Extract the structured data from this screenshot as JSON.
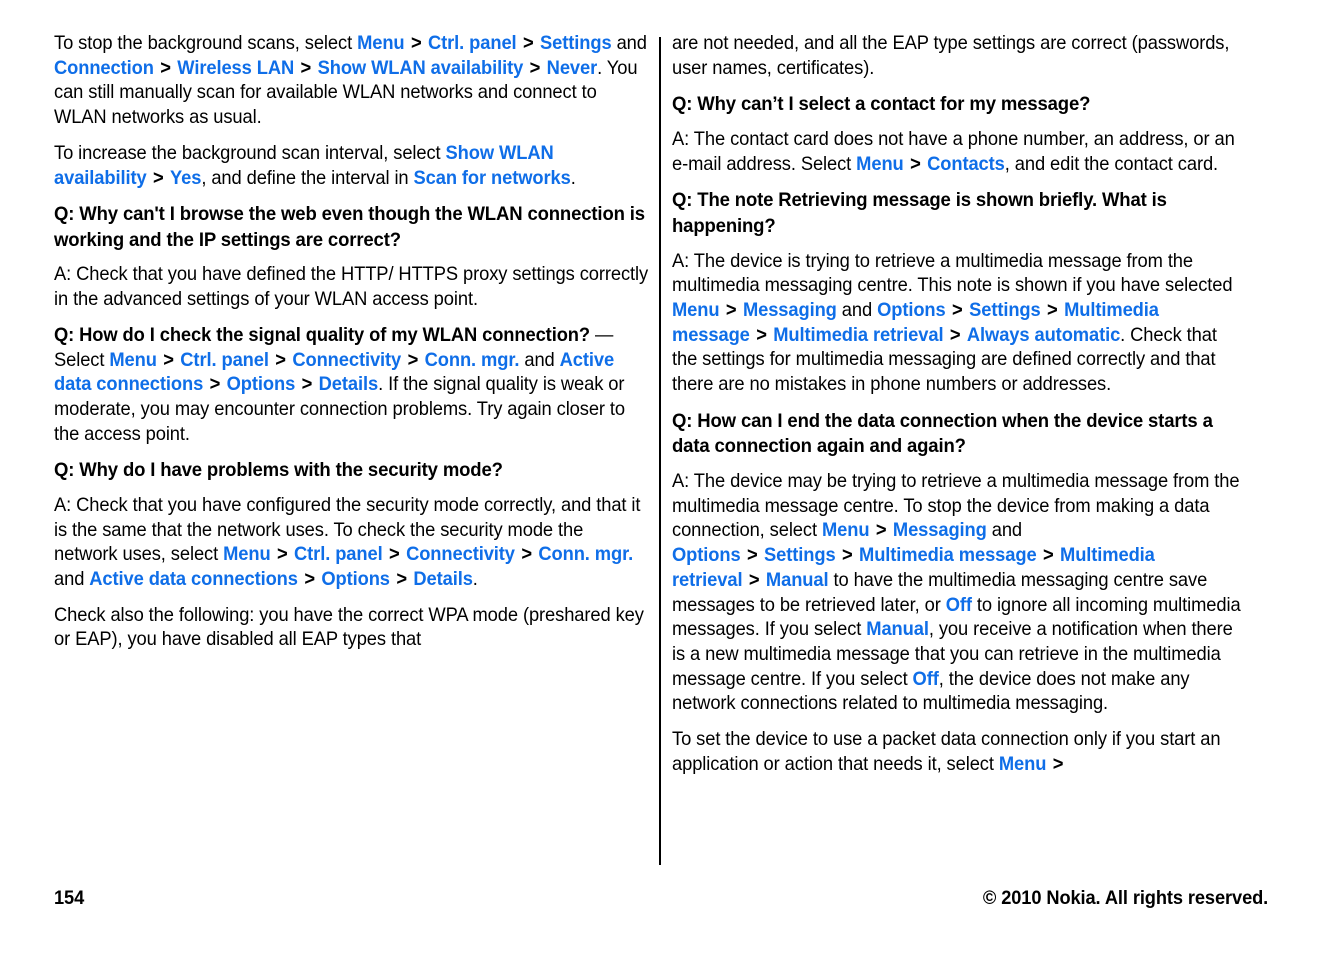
{
  "document": {
    "page_number": "154",
    "copyright": "© 2010 Nokia. All rights reserved.",
    "link_color": "#0f6ee8",
    "text_color": "#000000",
    "background_color": "#ffffff"
  },
  "left_column": {
    "blocks": [
      {
        "type": "paragraph",
        "id": "stop-background-scans",
        "runs": [
          {
            "t": "plain",
            "v": "To stop the background scans, select "
          },
          {
            "t": "link",
            "v": "Menu"
          },
          {
            "t": "sep",
            "v": ">"
          },
          {
            "t": "link",
            "v": "Ctrl. panel"
          },
          {
            "t": "sep",
            "v": ">"
          },
          {
            "t": "link",
            "v": "Settings"
          },
          {
            "t": "plain",
            "v": " and "
          },
          {
            "t": "link",
            "v": "Connection"
          },
          {
            "t": "sep",
            "v": ">"
          },
          {
            "t": "link",
            "v": "Wireless LAN"
          },
          {
            "t": "sep",
            "v": ">"
          },
          {
            "t": "link",
            "v": "Show WLAN availability"
          },
          {
            "t": "sep",
            "v": ">"
          },
          {
            "t": "link",
            "v": "Never"
          },
          {
            "t": "plain",
            "v": ". You can still manually scan for available WLAN networks and connect to WLAN networks as usual."
          }
        ]
      },
      {
        "type": "paragraph",
        "id": "increase-scan-interval",
        "runs": [
          {
            "t": "plain",
            "v": "To increase the background scan interval, select "
          },
          {
            "t": "link",
            "v": "Show WLAN availability"
          },
          {
            "t": "sep",
            "v": ">"
          },
          {
            "t": "link",
            "v": "Yes"
          },
          {
            "t": "plain",
            "v": ", and define the interval in "
          },
          {
            "t": "link",
            "v": "Scan for networks"
          },
          {
            "t": "plain",
            "v": "."
          }
        ]
      },
      {
        "type": "heading",
        "id": "q-browse-web",
        "runs": [
          {
            "t": "plain",
            "v": "Q: Why can't I browse the web even though the WLAN connection is working and the IP settings are correct?"
          }
        ]
      },
      {
        "type": "paragraph",
        "id": "a-browse-web",
        "runs": [
          {
            "t": "plain",
            "v": "A: Check that you have defined the HTTP/ HTTPS proxy settings correctly in the advanced settings of your WLAN access point."
          }
        ]
      },
      {
        "type": "paragraph",
        "id": "q-signal-quality",
        "runs": [
          {
            "t": "bold",
            "v": "Q: How do I check the signal quality of my WLAN connection?"
          },
          {
            "t": "plain",
            "v": " —  Select "
          },
          {
            "t": "link",
            "v": "Menu"
          },
          {
            "t": "sep",
            "v": ">"
          },
          {
            "t": "link",
            "v": "Ctrl. panel"
          },
          {
            "t": "sep",
            "v": ">"
          },
          {
            "t": "link",
            "v": "Connectivity"
          },
          {
            "t": "sep",
            "v": ">"
          },
          {
            "t": "link",
            "v": "Conn. mgr."
          },
          {
            "t": "plain",
            "v": " and "
          },
          {
            "t": "link",
            "v": "Active data connections"
          },
          {
            "t": "sep",
            "v": ">"
          },
          {
            "t": "link",
            "v": "Options"
          },
          {
            "t": "sep",
            "v": ">"
          },
          {
            "t": "link",
            "v": "Details"
          },
          {
            "t": "plain",
            "v": ". If the signal quality is weak or moderate, you may encounter connection problems. Try again closer to the access point."
          }
        ]
      },
      {
        "type": "heading",
        "id": "q-security-mode",
        "runs": [
          {
            "t": "plain",
            "v": "Q: Why do I have problems with the security mode?"
          }
        ]
      },
      {
        "type": "paragraph",
        "id": "a-security-mode",
        "runs": [
          {
            "t": "plain",
            "v": "A: Check that you have configured the security mode correctly, and that it is the same that the network uses. To check the security mode the network uses, select "
          },
          {
            "t": "link",
            "v": "Menu"
          },
          {
            "t": "sep",
            "v": ">"
          },
          {
            "t": "link",
            "v": "Ctrl. panel"
          },
          {
            "t": "sep",
            "v": ">"
          },
          {
            "t": "link",
            "v": "Connectivity"
          },
          {
            "t": "sep",
            "v": ">"
          },
          {
            "t": "link",
            "v": "Conn. mgr."
          },
          {
            "t": "plain",
            "v": " and "
          },
          {
            "t": "link",
            "v": "Active data connections"
          },
          {
            "t": "sep",
            "v": ">"
          },
          {
            "t": "link",
            "v": "Options"
          },
          {
            "t": "sep",
            "v": ">"
          },
          {
            "t": "link",
            "v": "Details"
          },
          {
            "t": "plain",
            "v": "."
          }
        ]
      },
      {
        "type": "paragraph",
        "id": "check-also-following",
        "runs": [
          {
            "t": "plain",
            "v": "Check also the following: you have the correct WPA mode (preshared key or EAP), you have disabled all EAP types that"
          }
        ]
      }
    ]
  },
  "right_column": {
    "blocks": [
      {
        "type": "paragraph",
        "id": "eap-continuation",
        "runs": [
          {
            "t": "plain",
            "v": "are not needed, and all the EAP type settings are correct (passwords, user names, certificates)."
          }
        ]
      },
      {
        "type": "heading",
        "id": "q-select-contact",
        "runs": [
          {
            "t": "plain",
            "v": "Q: Why can’t I select a contact for my message?"
          }
        ]
      },
      {
        "type": "paragraph",
        "id": "a-select-contact",
        "runs": [
          {
            "t": "plain",
            "v": "A: The contact card does not have a phone number, an address, or an e-mail address. Select "
          },
          {
            "t": "link",
            "v": "Menu"
          },
          {
            "t": "sep",
            "v": ">"
          },
          {
            "t": "link",
            "v": "Contacts"
          },
          {
            "t": "plain",
            "v": ", and edit the contact card."
          }
        ]
      },
      {
        "type": "heading",
        "id": "q-retrieving-message",
        "runs": [
          {
            "t": "plain",
            "v": "Q: The note Retrieving message is shown briefly. What is happening?"
          }
        ]
      },
      {
        "type": "paragraph",
        "id": "a-retrieving-message",
        "runs": [
          {
            "t": "plain",
            "v": "A: The device is trying to retrieve a multimedia message from the multimedia messaging centre. This note is shown if you have selected "
          },
          {
            "t": "link",
            "v": "Menu"
          },
          {
            "t": "sep",
            "v": ">"
          },
          {
            "t": "link",
            "v": "Messaging"
          },
          {
            "t": "plain",
            "v": " and "
          },
          {
            "t": "link",
            "v": "Options"
          },
          {
            "t": "sep",
            "v": ">"
          },
          {
            "t": "link",
            "v": "Settings"
          },
          {
            "t": "sep",
            "v": ">"
          },
          {
            "t": "link",
            "v": "Multimedia message"
          },
          {
            "t": "sep",
            "v": ">"
          },
          {
            "t": "link",
            "v": "Multimedia retrieval"
          },
          {
            "t": "sep",
            "v": ">"
          },
          {
            "t": "link",
            "v": "Always automatic"
          },
          {
            "t": "plain",
            "v": ". Check that the settings for multimedia messaging are defined correctly and that there are no mistakes in phone numbers or addresses."
          }
        ]
      },
      {
        "type": "heading",
        "id": "q-end-data-connection",
        "runs": [
          {
            "t": "plain",
            "v": "Q: How can I end the data connection when the device starts a data connection again and again?"
          }
        ]
      },
      {
        "type": "paragraph",
        "id": "a-end-data-connection",
        "runs": [
          {
            "t": "plain",
            "v": "A: The device may be trying to retrieve a multimedia message from the multimedia message centre. To stop the device from making a data connection, select "
          },
          {
            "t": "link",
            "v": "Menu"
          },
          {
            "t": "sep",
            "v": ">"
          },
          {
            "t": "link",
            "v": "Messaging"
          },
          {
            "t": "plain",
            "v": " and "
          },
          {
            "t": "link",
            "v": "Options"
          },
          {
            "t": "sep",
            "v": ">"
          },
          {
            "t": "link",
            "v": "Settings"
          },
          {
            "t": "sep",
            "v": ">"
          },
          {
            "t": "link",
            "v": "Multimedia message"
          },
          {
            "t": "sep",
            "v": ">"
          },
          {
            "t": "link",
            "v": "Multimedia retrieval"
          },
          {
            "t": "sep",
            "v": ">"
          },
          {
            "t": "link",
            "v": "Manual"
          },
          {
            "t": "plain",
            "v": " to have the multimedia messaging centre save messages to be retrieved later, or "
          },
          {
            "t": "link",
            "v": "Off"
          },
          {
            "t": "plain",
            "v": " to ignore all incoming multimedia messages. If you select "
          },
          {
            "t": "link",
            "v": "Manual"
          },
          {
            "t": "plain",
            "v": ", you receive a notification when there is a new multimedia message that you can retrieve in the multimedia message centre. If you select "
          },
          {
            "t": "link",
            "v": "Off"
          },
          {
            "t": "plain",
            "v": ", the device does not make any network connections related to multimedia messaging."
          }
        ]
      },
      {
        "type": "paragraph",
        "id": "packet-data-connection",
        "runs": [
          {
            "t": "plain",
            "v": "To set the device to use a packet data connection only if you start an application or action that needs it, select "
          },
          {
            "t": "link",
            "v": "Menu"
          },
          {
            "t": "sep",
            "v": ">"
          }
        ]
      }
    ]
  }
}
